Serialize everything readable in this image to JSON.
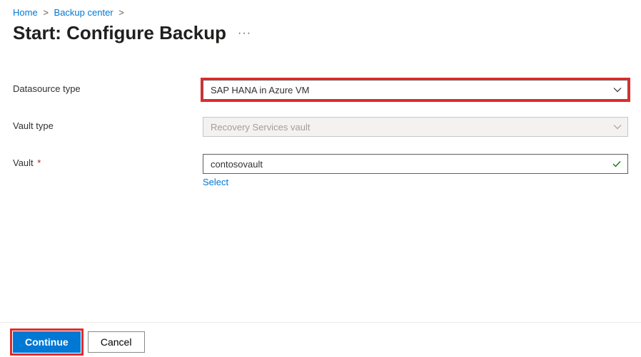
{
  "breadcrumb": {
    "home": "Home",
    "backup_center": "Backup center"
  },
  "page_title": "Start: Configure Backup",
  "more_dots": "···",
  "fields": {
    "datasource_type": {
      "label": "Datasource type",
      "value": "SAP HANA in Azure VM"
    },
    "vault_type": {
      "label": "Vault type",
      "value": "Recovery Services vault"
    },
    "vault": {
      "label": "Vault",
      "value": "contosovault",
      "select_link": "Select"
    }
  },
  "footer": {
    "continue": "Continue",
    "cancel": "Cancel"
  }
}
